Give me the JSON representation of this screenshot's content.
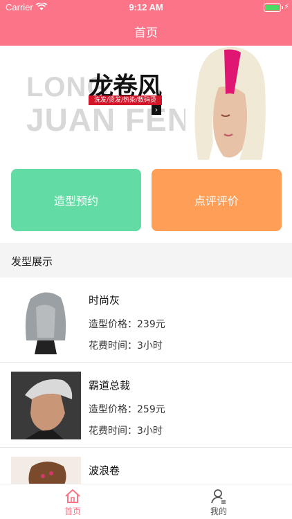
{
  "status_bar": {
    "carrier": "Carrier",
    "time": "9:12 AM",
    "battery_level": 1.0
  },
  "nav": {
    "title": "首页"
  },
  "banner": {
    "ghost_line1": "LONG",
    "ghost_line2": "JUAN FENG",
    "brand": "龙卷风",
    "tagline": "洗发/烫发/热染/数码烫"
  },
  "actions": {
    "book_label": "造型预约",
    "review_label": "点评评价"
  },
  "section": {
    "title": "发型展示"
  },
  "hairstyles": [
    {
      "name": "时尚灰",
      "price": "造型价格：239元",
      "time": "花费时间：3小时"
    },
    {
      "name": "霸道总裁",
      "price": "造型价格：259元",
      "time": "花费时间：3小时"
    },
    {
      "name": "波浪卷"
    }
  ],
  "tabbar": {
    "home_label": "首页",
    "me_label": "我的"
  },
  "colors": {
    "accent": "#fb7487",
    "book_button": "#63dba4",
    "review_button": "#ff9e56",
    "section_bg": "#f4f4f4"
  }
}
